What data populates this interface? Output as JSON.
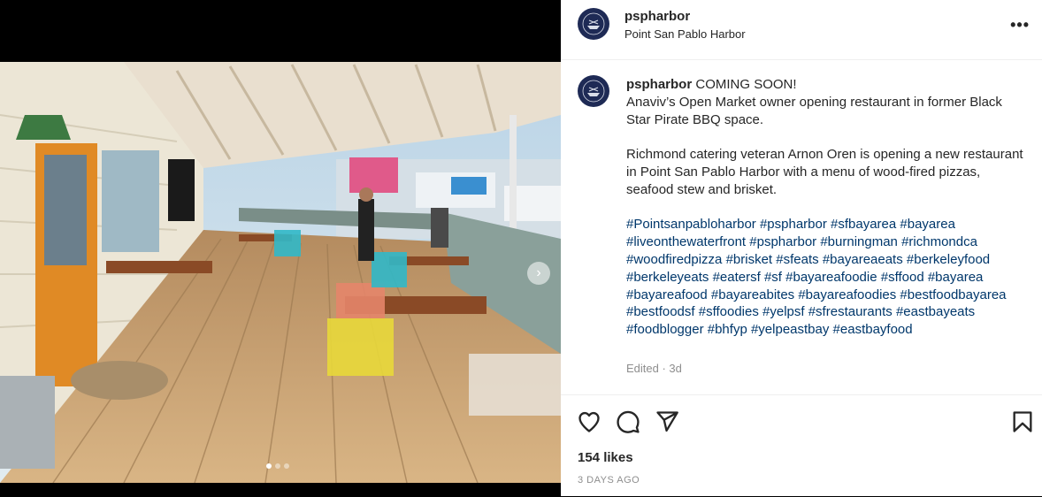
{
  "post": {
    "username": "pspharbor",
    "location": "Point San Pablo Harbor",
    "avatar_text": "POINT SAN PABLO HARBOR",
    "more_label": "•••",
    "caption": {
      "headline": "COMING SOON!",
      "line1": "Anaviv’s Open Market owner opening restaurant in former Black Star Pirate BBQ space.",
      "line2": "Richmond catering veteran Arnon Oren is opening a new restaurant in Point San Pablo Harbor with a menu of wood-fired pizzas, seafood stew and brisket.",
      "hashtags": [
        "#Pointsanpabloharbor",
        "#pspharbor",
        "#sfbayarea",
        "#bayarea",
        "#liveonthewaterfront",
        "#pspharbor",
        "#burningman",
        "#richmondca",
        "#woodfiredpizza",
        "#brisket",
        "#sfeats",
        "#bayareaeats",
        "#berkeleyfood",
        "#berkeleyeats",
        "#eatersf",
        "#sf",
        "#bayareafoodie",
        "#sffood",
        "#bayarea",
        "#bayareafood",
        "#bayareabites",
        "#bayareafoodies",
        "#bestfoodbayarea",
        "#bestfoodsf",
        "#sffoodies",
        "#yelpsf",
        "#sfrestaurants",
        "#eastbayeats",
        "#foodblogger",
        "#bhfyp",
        "#yelpeastbay",
        "#eastbayfood"
      ]
    },
    "edited": "Edited · 3d",
    "likes": "154 likes",
    "time_ago": "3 DAYS AGO",
    "carousel": {
      "count": 3,
      "active_index": 0
    }
  },
  "icons": [
    "heart-icon",
    "comment-icon",
    "share-icon",
    "bookmark-icon",
    "chevron-right-icon"
  ]
}
